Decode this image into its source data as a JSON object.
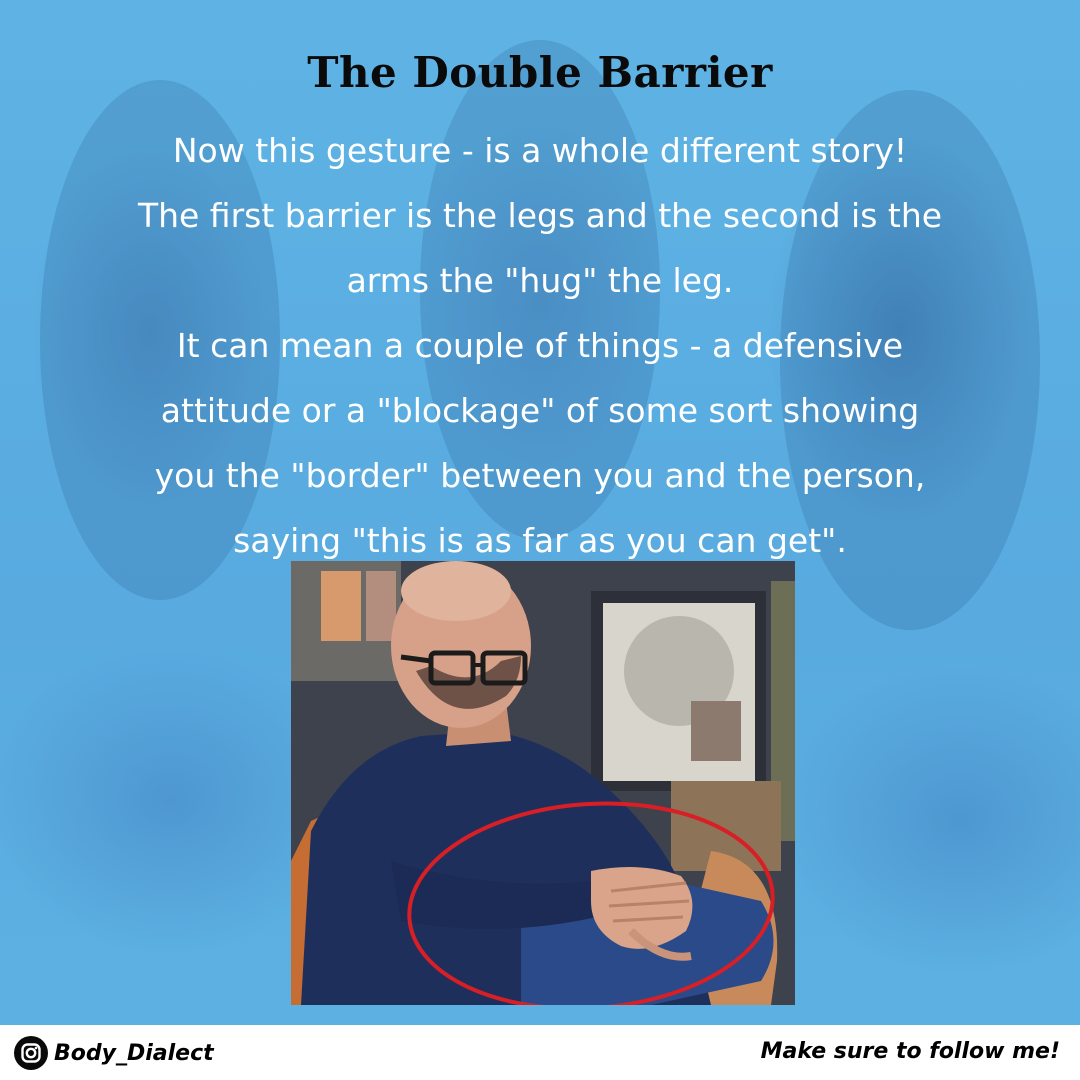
{
  "post": {
    "title": "The Double Barrier",
    "lines": [
      "Now this gesture - is a whole different story!",
      "The first barrier is the legs and the second is the",
      "arms the \"hug\" the leg.",
      "It can mean a couple of things - a defensive",
      "attitude or a \"blockage\" of some sort showing",
      "you the \"border\" between you and the person,",
      "saying \"this is as far as you can get\"."
    ],
    "background_color": "#5aaee0",
    "highlight_color": "#d81f26"
  },
  "photo": {
    "icon": "man-crossed-legs-photo"
  },
  "footer": {
    "icon": "instagram-icon",
    "handle": "Body_Dialect",
    "cta": "Make sure to follow me!"
  }
}
